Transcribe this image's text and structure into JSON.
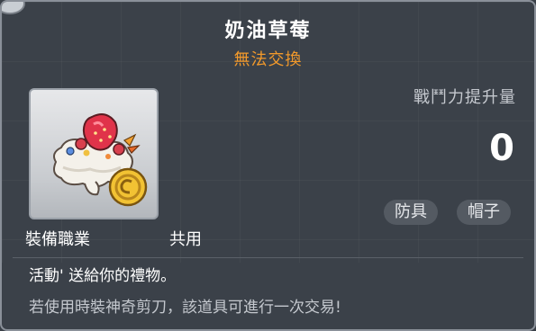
{
  "item": {
    "name": "奶油草莓",
    "trade_status": "無法交換",
    "icon": "strawberry-cream-hat-icon"
  },
  "stats": {
    "power_label": "戰鬥力提升量",
    "power_value": "0"
  },
  "tags": [
    "防具",
    "帽子"
  ],
  "job": {
    "label": "裝備職業",
    "value": "共用"
  },
  "description": {
    "line1": "活動' 送給你的禮物。",
    "line2": "若使用時裝神奇剪刀，該道具可進行一次交易!"
  },
  "colors": {
    "title": "#ffffff",
    "trade_status": "#f39a2b",
    "background": "#3b4149",
    "tag_bg": "#545a62"
  }
}
